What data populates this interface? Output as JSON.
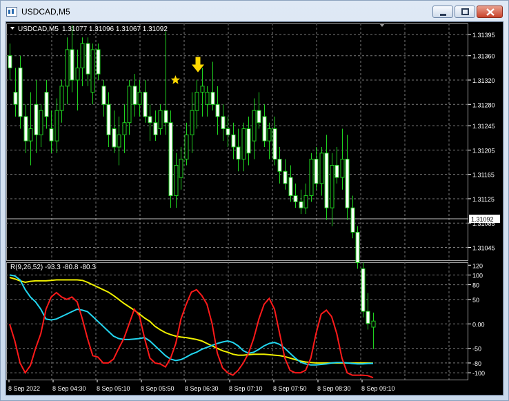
{
  "window": {
    "title": "USDCAD,M5"
  },
  "main_chart": {
    "symbol_label": "USDCAD,M5",
    "ohlc_label": "1.31077 1.31096 1.31067 1.31092",
    "price_ticks": [
      "1.31395",
      "1.31360",
      "1.31320",
      "1.31280",
      "1.31245",
      "1.31205",
      "1.31165",
      "1.31125",
      "1.31085",
      "1.31045"
    ],
    "current_price": "1.31092",
    "colors": {
      "background": "#000000",
      "bull": "#ffffff",
      "bear": "#ffffff",
      "wick": "#1fd21f",
      "grid": "#808080",
      "marker": "#ffd800"
    },
    "annotations": [
      "down-arrow-marker",
      "star-marker"
    ]
  },
  "indicator": {
    "label": "R(9,26,52) -93.3 -80.8 -80.3",
    "ticks": [
      "120",
      "100",
      "80",
      "50",
      "0.00",
      "-50",
      "-80",
      "-100"
    ],
    "series_colors": {
      "fast": "#ff1a1a",
      "medium": "#22d6f0",
      "slow": "#f0f000"
    }
  },
  "time_axis": {
    "labels": [
      "8 Sep 2022",
      "8 Sep 04:30",
      "8 Sep 05:10",
      "8 Sep 05:50",
      "8 Sep 06:30",
      "8 Sep 07:10",
      "8 Sep 07:50",
      "8 Sep 08:30",
      "8 Sep 09:10"
    ]
  },
  "chart_data": {
    "type": "candlestick",
    "candles": [
      {
        "o": 1.3136,
        "h": 1.3138,
        "l": 1.3132,
        "c": 1.3134
      },
      {
        "o": 1.313,
        "h": 1.3134,
        "l": 1.3126,
        "c": 1.3128
      },
      {
        "o": 1.3134,
        "h": 1.3136,
        "l": 1.3124,
        "c": 1.3126
      },
      {
        "o": 1.3126,
        "h": 1.3128,
        "l": 1.312,
        "c": 1.3122
      },
      {
        "o": 1.3122,
        "h": 1.313,
        "l": 1.3118,
        "c": 1.3124
      },
      {
        "o": 1.3128,
        "h": 1.3132,
        "l": 1.312,
        "c": 1.3123
      },
      {
        "o": 1.3123,
        "h": 1.3128,
        "l": 1.3121,
        "c": 1.3127
      },
      {
        "o": 1.313,
        "h": 1.3132,
        "l": 1.3124,
        "c": 1.3126
      },
      {
        "o": 1.3124,
        "h": 1.3127,
        "l": 1.312,
        "c": 1.3122
      },
      {
        "o": 1.3122,
        "h": 1.3129,
        "l": 1.312,
        "c": 1.3127
      },
      {
        "o": 1.3127,
        "h": 1.3132,
        "l": 1.3125,
        "c": 1.3131
      },
      {
        "o": 1.3131,
        "h": 1.3139,
        "l": 1.3128,
        "c": 1.3137
      },
      {
        "o": 1.3137,
        "h": 1.3141,
        "l": 1.313,
        "c": 1.3132
      },
      {
        "o": 1.3132,
        "h": 1.3137,
        "l": 1.3127,
        "c": 1.3134
      },
      {
        "o": 1.3134,
        "h": 1.3139,
        "l": 1.3131,
        "c": 1.3138
      },
      {
        "o": 1.3138,
        "h": 1.3139,
        "l": 1.3131,
        "c": 1.3133
      },
      {
        "o": 1.313,
        "h": 1.3138,
        "l": 1.3128,
        "c": 1.3137
      },
      {
        "o": 1.3137,
        "h": 1.3138,
        "l": 1.3132,
        "c": 1.3133
      },
      {
        "o": 1.3131,
        "h": 1.3132,
        "l": 1.3126,
        "c": 1.3128
      },
      {
        "o": 1.3128,
        "h": 1.313,
        "l": 1.3121,
        "c": 1.3123
      },
      {
        "o": 1.3124,
        "h": 1.3127,
        "l": 1.312,
        "c": 1.3121
      },
      {
        "o": 1.3121,
        "h": 1.3126,
        "l": 1.3118,
        "c": 1.3123
      },
      {
        "o": 1.3123,
        "h": 1.3128,
        "l": 1.312,
        "c": 1.3125
      },
      {
        "o": 1.3125,
        "h": 1.3132,
        "l": 1.3123,
        "c": 1.3131
      },
      {
        "o": 1.3131,
        "h": 1.3133,
        "l": 1.3126,
        "c": 1.3128
      },
      {
        "o": 1.3128,
        "h": 1.3132,
        "l": 1.3126,
        "c": 1.313
      },
      {
        "o": 1.313,
        "h": 1.3132,
        "l": 1.3125,
        "c": 1.3126
      },
      {
        "o": 1.3126,
        "h": 1.3128,
        "l": 1.3122,
        "c": 1.3125
      },
      {
        "o": 1.3125,
        "h": 1.3127,
        "l": 1.3122,
        "c": 1.3123
      },
      {
        "o": 1.3124,
        "h": 1.3128,
        "l": 1.3123,
        "c": 1.3127
      },
      {
        "o": 1.3127,
        "h": 1.314,
        "l": 1.3123,
        "c": 1.3125
      },
      {
        "o": 1.3125,
        "h": 1.3127,
        "l": 1.3111,
        "c": 1.3113
      },
      {
        "o": 1.3113,
        "h": 1.312,
        "l": 1.3111,
        "c": 1.3118
      },
      {
        "o": 1.3116,
        "h": 1.3121,
        "l": 1.3114,
        "c": 1.3119
      },
      {
        "o": 1.3119,
        "h": 1.3125,
        "l": 1.3118,
        "c": 1.3123
      },
      {
        "o": 1.3123,
        "h": 1.313,
        "l": 1.312,
        "c": 1.3127
      },
      {
        "o": 1.3127,
        "h": 1.3132,
        "l": 1.3124,
        "c": 1.313
      },
      {
        "o": 1.313,
        "h": 1.3134,
        "l": 1.3126,
        "c": 1.3131
      },
      {
        "o": 1.3128,
        "h": 1.3131,
        "l": 1.3126,
        "c": 1.313
      },
      {
        "o": 1.313,
        "h": 1.3135,
        "l": 1.3127,
        "c": 1.3128
      },
      {
        "o": 1.3128,
        "h": 1.3131,
        "l": 1.3123,
        "c": 1.3126
      },
      {
        "o": 1.3126,
        "h": 1.3128,
        "l": 1.3122,
        "c": 1.3124
      },
      {
        "o": 1.3124,
        "h": 1.3126,
        "l": 1.3121,
        "c": 1.3123
      },
      {
        "o": 1.3123,
        "h": 1.3125,
        "l": 1.3119,
        "c": 1.3121
      },
      {
        "o": 1.3121,
        "h": 1.3124,
        "l": 1.3117,
        "c": 1.3119
      },
      {
        "o": 1.3119,
        "h": 1.3125,
        "l": 1.3117,
        "c": 1.3124
      },
      {
        "o": 1.3124,
        "h": 1.3126,
        "l": 1.3118,
        "c": 1.312
      },
      {
        "o": 1.3122,
        "h": 1.3129,
        "l": 1.3119,
        "c": 1.3127
      },
      {
        "o": 1.3127,
        "h": 1.313,
        "l": 1.3124,
        "c": 1.3125
      },
      {
        "o": 1.3126,
        "h": 1.3128,
        "l": 1.3121,
        "c": 1.3122
      },
      {
        "o": 1.3122,
        "h": 1.3125,
        "l": 1.3119,
        "c": 1.3124
      },
      {
        "o": 1.3124,
        "h": 1.3126,
        "l": 1.3118,
        "c": 1.3119
      },
      {
        "o": 1.3119,
        "h": 1.3121,
        "l": 1.3115,
        "c": 1.3117
      },
      {
        "o": 1.3117,
        "h": 1.3119,
        "l": 1.3114,
        "c": 1.3115
      },
      {
        "o": 1.3116,
        "h": 1.3118,
        "l": 1.3112,
        "c": 1.3113
      },
      {
        "o": 1.3113,
        "h": 1.3115,
        "l": 1.3111,
        "c": 1.3112
      },
      {
        "o": 1.3112,
        "h": 1.3114,
        "l": 1.311,
        "c": 1.3111
      },
      {
        "o": 1.3111,
        "h": 1.3115,
        "l": 1.311,
        "c": 1.3113
      },
      {
        "o": 1.3113,
        "h": 1.312,
        "l": 1.3112,
        "c": 1.3119
      },
      {
        "o": 1.3119,
        "h": 1.3121,
        "l": 1.3114,
        "c": 1.3115
      },
      {
        "o": 1.3115,
        "h": 1.3121,
        "l": 1.3113,
        "c": 1.312
      },
      {
        "o": 1.312,
        "h": 1.3123,
        "l": 1.3109,
        "c": 1.3111
      },
      {
        "o": 1.3111,
        "h": 1.312,
        "l": 1.3108,
        "c": 1.3118
      },
      {
        "o": 1.3118,
        "h": 1.3121,
        "l": 1.3115,
        "c": 1.3116
      },
      {
        "o": 1.3116,
        "h": 1.3124,
        "l": 1.3114,
        "c": 1.3119
      },
      {
        "o": 1.3119,
        "h": 1.3123,
        "l": 1.3109,
        "c": 1.3111
      },
      {
        "o": 1.3111,
        "h": 1.3113,
        "l": 1.3106,
        "c": 1.3107
      },
      {
        "o": 1.3107,
        "h": 1.3108,
        "l": 1.3101,
        "c": 1.3102
      },
      {
        "o": 1.3101,
        "h": 1.3102,
        "l": 1.3093,
        "c": 1.3094
      },
      {
        "o": 1.3094,
        "h": 1.3097,
        "l": 1.3091,
        "c": 1.3092
      },
      {
        "o": 1.30914,
        "h": 1.30938,
        "l": 1.30878,
        "c": 1.30924
      }
    ],
    "indicator_series": [
      {
        "name": "fast",
        "values": [
          -0.5,
          -35,
          -80,
          -100,
          -85,
          -50,
          -20,
          30,
          55,
          64,
          55,
          50,
          55,
          45,
          10,
          -30,
          -65,
          -68,
          -80,
          -80,
          -72,
          -50,
          -30,
          0,
          30,
          16,
          -30,
          -70,
          -80,
          -82,
          -88,
          -70,
          -40,
          10,
          40,
          65,
          70,
          58,
          40,
          0,
          -60,
          -90,
          -100,
          -105,
          -95,
          -80,
          -60,
          -30,
          10,
          40,
          52,
          30,
          -20,
          -70,
          -95,
          -100,
          -100,
          -95,
          -70,
          -20,
          20,
          28,
          15,
          -20,
          -70,
          -100,
          -105,
          -105,
          -105,
          -106,
          -110
        ],
        "note": ""
      },
      {
        "name": "medium",
        "values": [
          100,
          98,
          90,
          70,
          55,
          45,
          30,
          10,
          8,
          10,
          15,
          20,
          25,
          30,
          28,
          25,
          15,
          5,
          -5,
          -15,
          -25,
          -30,
          -32,
          -32,
          -31,
          -30,
          -28,
          -35,
          -45,
          -55,
          -65,
          -72,
          -75,
          -73,
          -68,
          -62,
          -58,
          -52,
          -48,
          -44,
          -40,
          -37,
          -35,
          -38,
          -45,
          -55,
          -60,
          -58,
          -52,
          -45,
          -40,
          -38,
          -42,
          -50,
          -60,
          -70,
          -78,
          -82,
          -84,
          -84,
          -83,
          -82,
          -80,
          -79,
          -79,
          -80,
          -81,
          -82,
          -82,
          -81,
          -80.8
        ]
      },
      {
        "name": "slow",
        "values": [
          95,
          92,
          88,
          85,
          87,
          88,
          88,
          88,
          89,
          90,
          90,
          90,
          90,
          90,
          89,
          85,
          80,
          75,
          70,
          65,
          58,
          50,
          42,
          35,
          28,
          20,
          12,
          5,
          -5,
          -12,
          -18,
          -22,
          -25,
          -27,
          -28,
          -30,
          -32,
          -35,
          -40,
          -45,
          -50,
          -55,
          -58,
          -62,
          -64,
          -64,
          -63,
          -62,
          -62,
          -62,
          -63,
          -64,
          -65,
          -67,
          -70,
          -73,
          -76,
          -78,
          -79,
          -80,
          -80,
          -80,
          -80,
          -80,
          -80,
          -80,
          -80,
          -80,
          -80,
          -80,
          -80.3
        ]
      }
    ]
  }
}
